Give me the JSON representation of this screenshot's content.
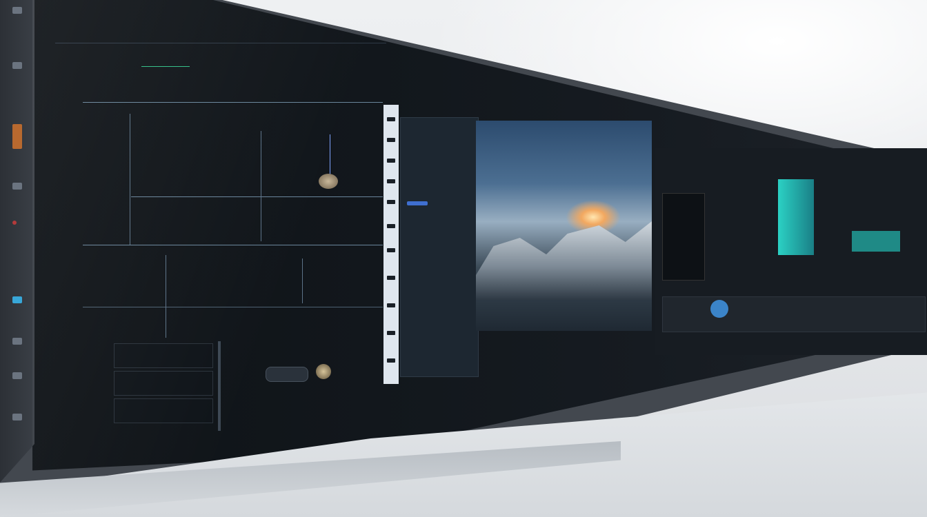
{
  "scene": {
    "description_free": true
  },
  "colors": {
    "wall": "#eef0f2",
    "bezel": "#43484f",
    "screen_bg": "#12171c",
    "accent_blue": "#5779c7",
    "accent_teal": "#2ba9a5",
    "sunset": "#f2a860"
  }
}
